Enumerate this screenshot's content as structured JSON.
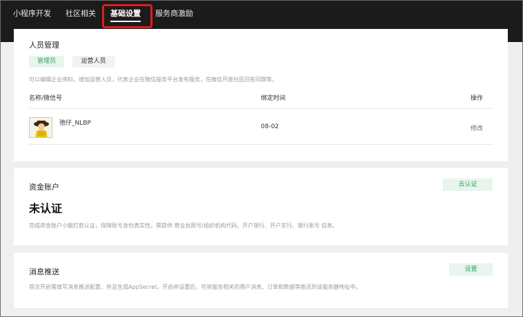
{
  "nav": {
    "tabs": [
      {
        "label": "小程序开发"
      },
      {
        "label": "社区相关"
      },
      {
        "label": "基础设置"
      },
      {
        "label": "服务商激励"
      }
    ]
  },
  "personnel": {
    "title": "人员管理",
    "roles": {
      "admin": "管理员",
      "operator": "运营人员"
    },
    "description": "可以编辑企业资料，增加运营人员，代表企业在微信服务平台发布服务，在微信开放社区回答问题等。",
    "columns": {
      "name": "名称/微信号",
      "bind_time": "绑定时间",
      "action": "操作"
    },
    "rows": [
      {
        "name": "弛仔_NLBP",
        "bind_time": "08-02",
        "action": "修改"
      }
    ]
  },
  "funds": {
    "title": "资金账户",
    "verify_button": "去认证",
    "status": "未认证",
    "description": "完成资金账户小额打款认证，保障账号身份真实性。需提供 营业执照号/组织机构代码、开户银行、开户支行、银行账号 信息。"
  },
  "push": {
    "title": "消息推送",
    "settings_button": "设置",
    "description": "首次开启需填写消息推送配置，并且生成AppSecret。开启并设置后，可将服务相关的用户消息、订单和数据等推送到该服务器地址中。"
  },
  "colors": {
    "topbar": "#1b1b1b",
    "accent_green": "#2fa55a",
    "highlight_red": "#e11b1b",
    "link_blue": "#576b95"
  }
}
